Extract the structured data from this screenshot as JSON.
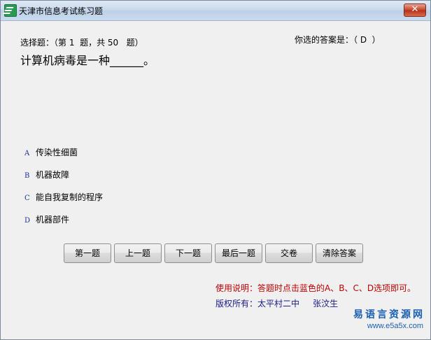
{
  "window": {
    "title": "天津市信息考试练习题",
    "close_label": "✕"
  },
  "question": {
    "meta": "选择题：（第 1  题，共 50   题）",
    "answer_status": "你选的答案是：（ D  ）",
    "text": "计算机病毒是一种______。",
    "options": [
      {
        "letter": "A",
        "text": "传染性细菌"
      },
      {
        "letter": "B",
        "text": "机器故障"
      },
      {
        "letter": "C",
        "text": "能自我复制的程序"
      },
      {
        "letter": "D",
        "text": "机器部件"
      }
    ]
  },
  "buttons": {
    "first": "第一题",
    "prev": "上一题",
    "next": "下一题",
    "last": "最后一题",
    "submit": "交卷",
    "clear": "清除答案"
  },
  "footer": {
    "instructions": "使用说明：答题时点击蓝色的A、B、C、D选项即可。",
    "copyright": "版权所有：太平村二中     张汶生"
  },
  "watermark": {
    "text": "易语言资源网",
    "url": "www.e5a5x.com"
  }
}
